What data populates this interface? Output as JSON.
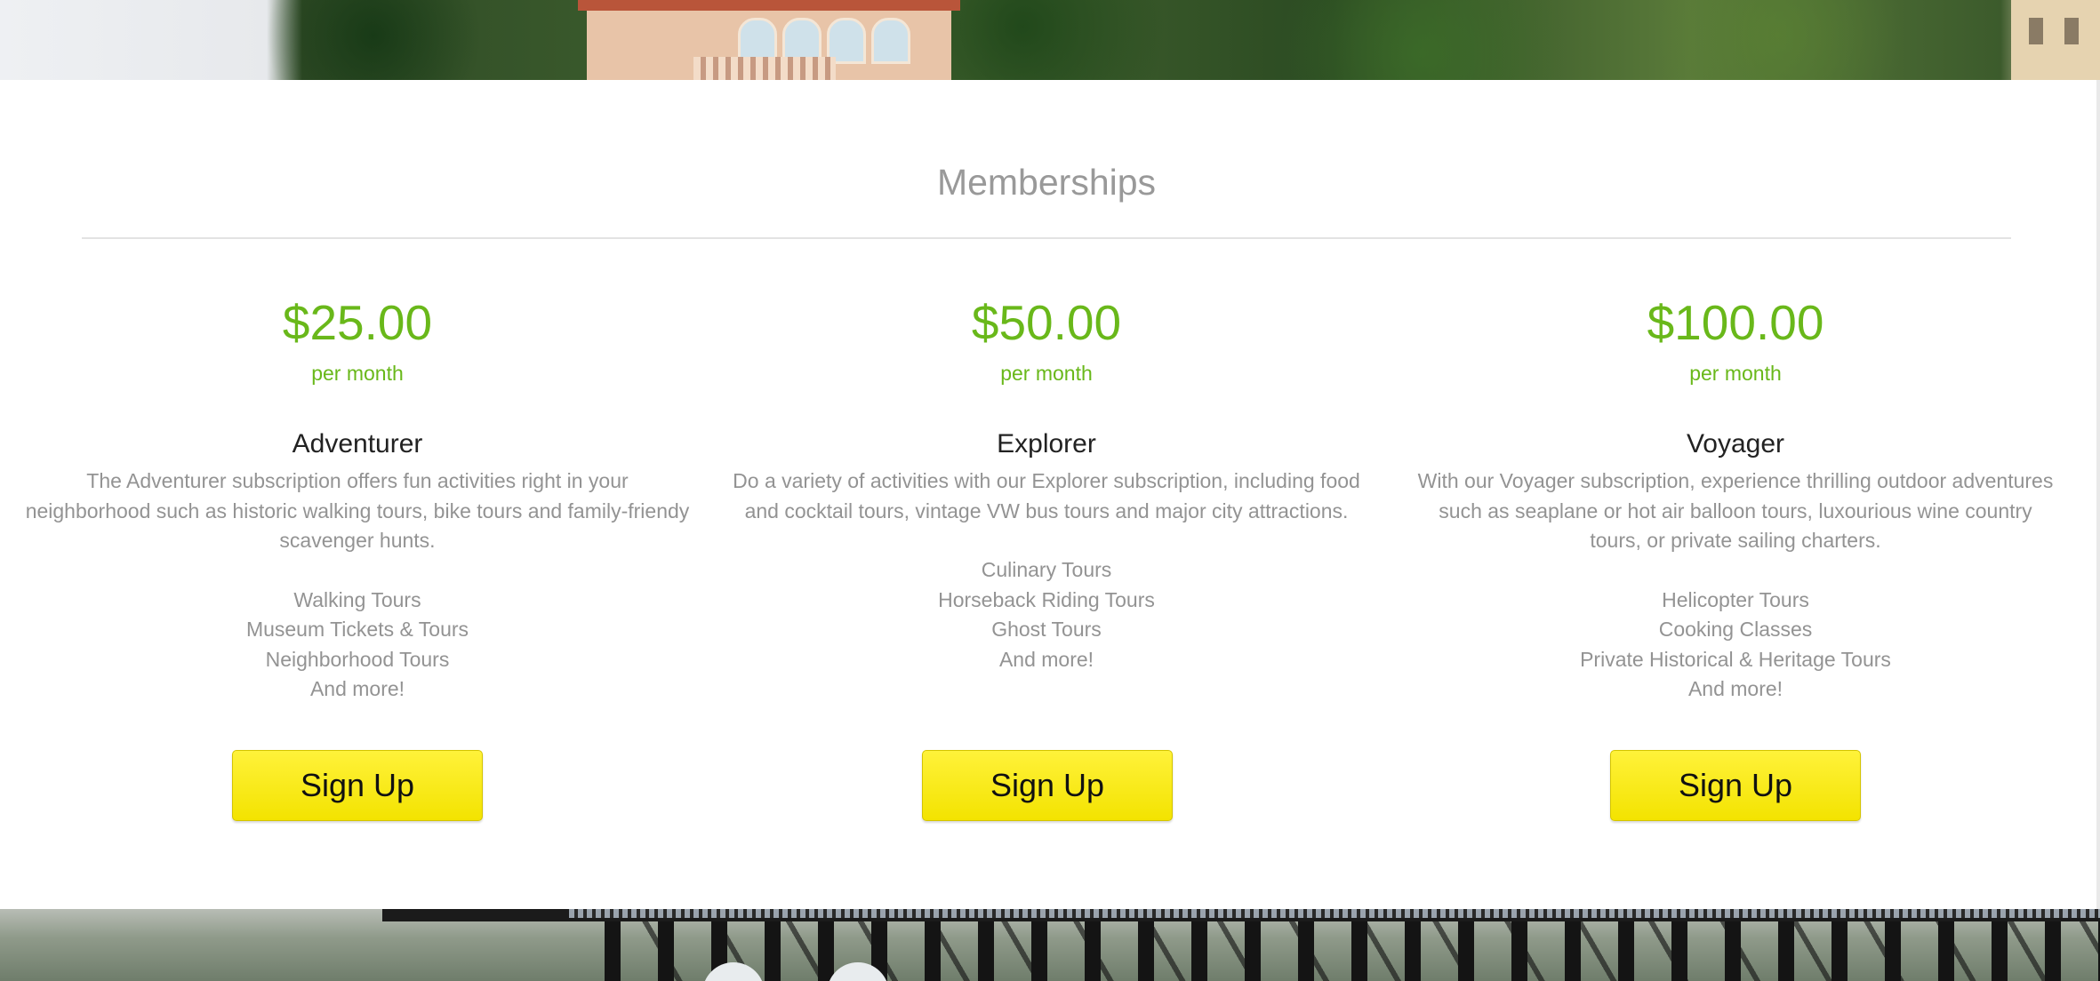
{
  "section": {
    "title": "Memberships"
  },
  "plans": [
    {
      "price": "$25.00",
      "period": "per month",
      "name": "Adventurer",
      "description": "The Adventurer subscription offers fun activities right in your neighborhood such as historic walking tours, bike tours and family-friendy scavenger hunts.",
      "features": [
        "Walking Tours",
        "Museum Tickets & Tours",
        "Neighborhood Tours",
        "And more!"
      ],
      "cta": "Sign Up"
    },
    {
      "price": "$50.00",
      "period": "per month",
      "name": "Explorer",
      "description": "Do a variety of activities with our Explorer subscription, including food and cocktail tours, vintage VW bus tours and major city attractions.",
      "features": [
        "Culinary Tours",
        "Horseback Riding Tours",
        "Ghost Tours",
        "And more!"
      ],
      "cta": "Sign Up"
    },
    {
      "price": "$100.00",
      "period": "per month",
      "name": "Voyager",
      "description": "With our Voyager subscription, experience thrilling outdoor adventures such as seaplane or hot air balloon tours, luxourious wine country tours, or private sailing charters.",
      "features": [
        "Helicopter Tours",
        "Cooking Classes",
        "Private Historical & Heritage Tours",
        "And more!"
      ],
      "cta": "Sign Up"
    }
  ],
  "colors": {
    "accent_green": "#69b81a",
    "button_yellow": "#f7e81a",
    "muted_text": "#939393"
  }
}
